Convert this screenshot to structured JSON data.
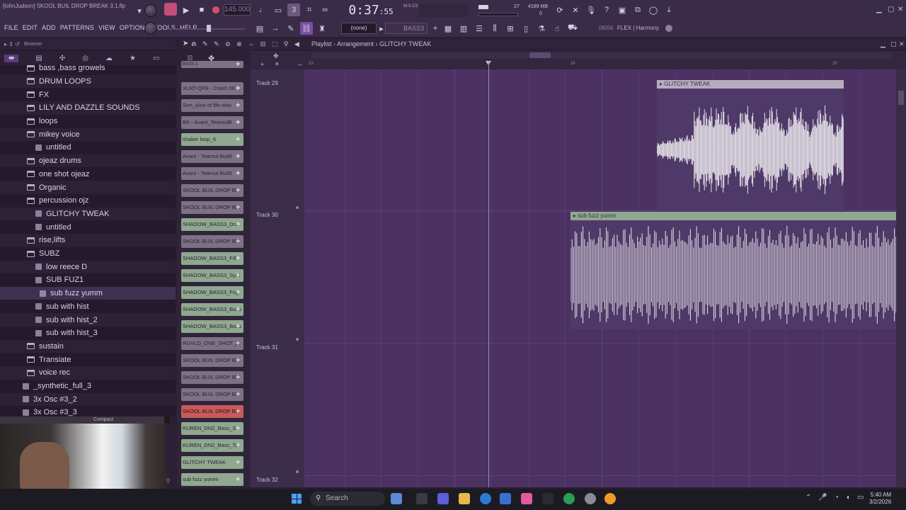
{
  "window": {
    "title": "[lohnJudson] SKOOL BUIL DROP BREAK 3.1.flp"
  },
  "menu": [
    "FILE",
    "EDIT",
    "ADD",
    "PATTERNS",
    "VIEW",
    "OPTIONS",
    "TOOLS",
    "HELP"
  ],
  "transport": {
    "tempo": "145.000",
    "time_main": "0:37",
    "time_sub": ":55",
    "time_unit": "M:S:CS"
  },
  "cpu": {
    "poly": "27",
    "mem": "4189 MB",
    "cpu_val": "0"
  },
  "toolbar": {
    "pattern": "(none)",
    "channel_name": "BASS3",
    "hint_number": "06/04",
    "hint_text": "FLEX | Harmony"
  },
  "browser": {
    "header": "Browser",
    "items": [
      {
        "label": "bass ,bass growels",
        "indent": 1,
        "type": "folder"
      },
      {
        "label": "DRUM LOOPS",
        "indent": 1,
        "type": "folder"
      },
      {
        "label": "FX",
        "indent": 1,
        "type": "folder"
      },
      {
        "label": "LILY AND DAZZLE SOUNDS",
        "indent": 1,
        "type": "folder"
      },
      {
        "label": "loops",
        "indent": 1,
        "type": "folder"
      },
      {
        "label": "mikey voice",
        "indent": 1,
        "type": "folder"
      },
      {
        "label": "untitled",
        "indent": 2,
        "type": "file"
      },
      {
        "label": "ojeaz drums",
        "indent": 1,
        "type": "folder"
      },
      {
        "label": "one shot ojeaz",
        "indent": 1,
        "type": "folder"
      },
      {
        "label": "Organic",
        "indent": 1,
        "type": "folder"
      },
      {
        "label": "percussion ojz",
        "indent": 1,
        "type": "folder"
      },
      {
        "label": "GLITCHY TWEAK",
        "indent": 2,
        "type": "file"
      },
      {
        "label": "untitled",
        "indent": 2,
        "type": "file"
      },
      {
        "label": "rise,lifts",
        "indent": 1,
        "type": "folder"
      },
      {
        "label": "SUBZ",
        "indent": 1,
        "type": "folder"
      },
      {
        "label": "low reece D",
        "indent": 2,
        "type": "file"
      },
      {
        "label": "SUB FUZ1",
        "indent": 2,
        "type": "file"
      },
      {
        "label": "sub fuzz yumm",
        "indent": 3,
        "type": "file"
      },
      {
        "label": "sub with hist",
        "indent": 2,
        "type": "file"
      },
      {
        "label": "sub with hist_2",
        "indent": 2,
        "type": "file"
      },
      {
        "label": "sub with hist_3",
        "indent": 2,
        "type": "file"
      },
      {
        "label": "sustain",
        "indent": 1,
        "type": "folder"
      },
      {
        "label": "Transiate",
        "indent": 1,
        "type": "folder"
      },
      {
        "label": "voice rec",
        "indent": 1,
        "type": "folder"
      },
      {
        "label": "_synthetic_full_3",
        "indent": 0,
        "type": "file"
      },
      {
        "label": "3x Osc #3_2",
        "indent": 0,
        "type": "file"
      },
      {
        "label": "3x Osc #3_3",
        "indent": 0,
        "type": "file"
      }
    ]
  },
  "channels": [
    {
      "label": "BASS 1",
      "color": "gray"
    },
    {
      "label": "XLNT-QFB - Crash 08",
      "color": "gray"
    },
    {
      "label": "Srm_slice of life who",
      "color": "gray"
    },
    {
      "label": "BK - Avant_TearoutB",
      "color": "gray"
    },
    {
      "label": "shaker loop_6",
      "color": "green"
    },
    {
      "label": "Avant - Tearout Build",
      "color": "gray"
    },
    {
      "label": "Avant - Tearout Build",
      "color": "gray"
    },
    {
      "label": "SKOOL BUIL DROP BR",
      "color": "gray"
    },
    {
      "label": "SKOOL BUIL DROP BR",
      "color": "gray"
    },
    {
      "label": "SHADOW_BASS3_Dru",
      "color": "green"
    },
    {
      "label": "SKOOL BUIL DROP BR",
      "color": "gray"
    },
    {
      "label": "SHADOW_BASS3_Fill",
      "color": "green"
    },
    {
      "label": "SHADOW_BASS3_Synt",
      "color": "green"
    },
    {
      "label": "SHADOW_BASS3_Fog",
      "color": "green"
    },
    {
      "label": "SHADOW_BASS3_Bass",
      "color": "green"
    },
    {
      "label": "SHADOW_BASS3_Bass",
      "color": "green"
    },
    {
      "label": "RUVLO_ONE_SHOT_D",
      "color": "gray"
    },
    {
      "label": "SKOOL BUIL DROP BR",
      "color": "gray"
    },
    {
      "label": "SKOOL BUIL DROP BR",
      "color": "gray"
    },
    {
      "label": "SKOOL BUIL DROP BR",
      "color": "gray"
    },
    {
      "label": "SKOOL BUIL DROP BR",
      "color": "red"
    },
    {
      "label": "KUREN_DN2_Bass_S",
      "color": "green"
    },
    {
      "label": "KUREN_DN2_Bass_To",
      "color": "green"
    },
    {
      "label": "GLITCHY TWEAK",
      "color": "green"
    },
    {
      "label": "sub fuzz yumm",
      "color": "green"
    }
  ],
  "playlist": {
    "title": "Playlist - Arrangement",
    "pattern": "GLITCHY TWEAK",
    "bar_numbers": [
      "23",
      "24",
      "25"
    ],
    "tracks": [
      {
        "label": "Track 29"
      },
      {
        "label": "Track 30"
      },
      {
        "label": "Track 31"
      },
      {
        "label": "Track 32"
      }
    ],
    "clips": [
      {
        "name": "GLITCHY TWEAK",
        "track": 0
      },
      {
        "name": "sub fuzz yumm",
        "track": 1
      }
    ]
  },
  "webcam": {
    "title": "Compact"
  },
  "taskbar": {
    "search_placeholder": "Search",
    "time": "5:40 AM",
    "date": "3/2/2026"
  },
  "colors": {
    "grid_bg": "#4b3262",
    "clip_glitch_header": "#b7acbe",
    "clip_sub_header": "#8fa88f",
    "waveform": "#e8e4ea"
  }
}
